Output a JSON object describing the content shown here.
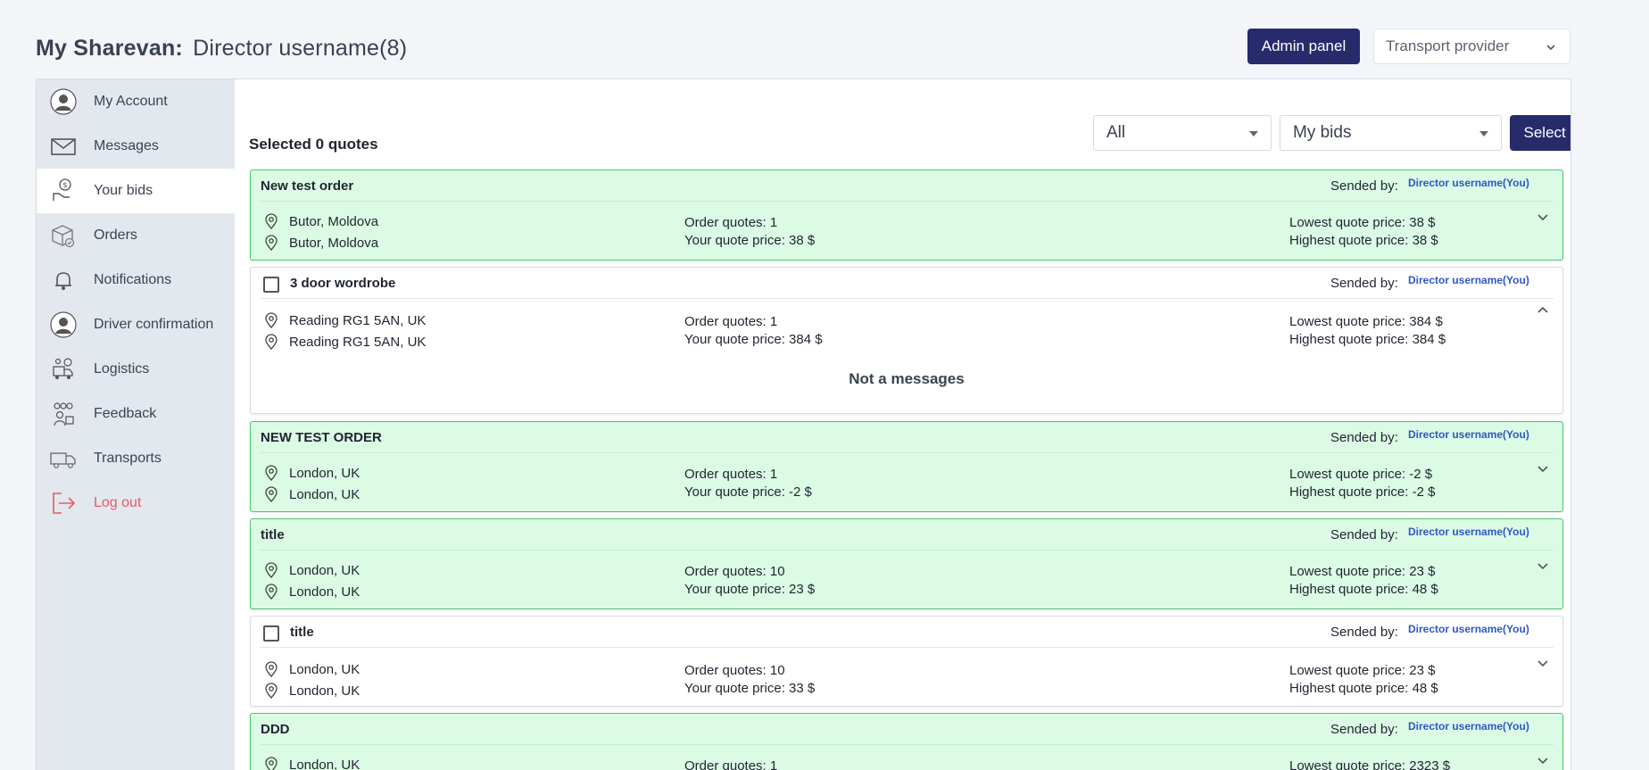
{
  "header": {
    "title": "My Sharevan:",
    "username": "Director username(8)",
    "admin_button": "Admin panel",
    "role_select": "Transport provider"
  },
  "sidebar": {
    "items": [
      {
        "label": "My Account",
        "icon": "user-avatar-icon"
      },
      {
        "label": "Messages",
        "icon": "envelope-icon"
      },
      {
        "label": "Your bids",
        "icon": "bid-icon"
      },
      {
        "label": "Orders",
        "icon": "box-icon"
      },
      {
        "label": "Notifications",
        "icon": "bell-icon"
      },
      {
        "label": "Driver confirmation",
        "icon": "driver-avatar-icon"
      },
      {
        "label": "Logistics",
        "icon": "logistics-icon"
      },
      {
        "label": "Feedback",
        "icon": "feedback-icon"
      },
      {
        "label": "Transports",
        "icon": "truck-icon"
      },
      {
        "label": "Log out",
        "icon": "logout-icon"
      }
    ],
    "active_index": 2
  },
  "toolbar": {
    "selected_text": "Selected 0 quotes",
    "filter_select": "All",
    "bids_select": "My bids",
    "select_all": "Select all"
  },
  "labels": {
    "sended_by": "Sended by:",
    "order_quotes": "Order quotes:",
    "your_quote_price": "Your quote price:",
    "lowest_quote_price": "Lowest quote price:",
    "highest_quote_price": "Highest quote price:"
  },
  "cards": [
    {
      "title": "New test order",
      "green": true,
      "checkbox": false,
      "sender": "Director username(You)",
      "from": "Butor, Moldova",
      "to": "Butor, Moldova",
      "order_quotes": "Order quotes: 1",
      "your_price": "Your quote price: 38 $",
      "lowest": "Lowest quote price: 38 $",
      "highest": "Highest quote price: 38 $",
      "expanded": false
    },
    {
      "title": "3 door wordrobe",
      "green": false,
      "checkbox": true,
      "sender": "Director username(You)",
      "from": "Reading RG1 5AN, UK",
      "to": "Reading RG1 5AN, UK",
      "order_quotes": "Order quotes: 1",
      "your_price": "Your quote price: 384 $",
      "lowest": "Lowest quote price: 384 $",
      "highest": "Highest quote price: 384 $",
      "expanded": true,
      "messages_text": "Not a messages"
    },
    {
      "title": "NEW TEST ORDER",
      "green": true,
      "checkbox": false,
      "sender": "Director username(You)",
      "from": "London, UK",
      "to": "London, UK",
      "order_quotes": "Order quotes: 1",
      "your_price": "Your quote price: -2 $",
      "lowest": "Lowest quote price: -2 $",
      "highest": "Highest quote price: -2 $",
      "expanded": false
    },
    {
      "title": "title",
      "green": true,
      "checkbox": false,
      "sender": "Director username(You)",
      "from": "London, UK",
      "to": "London, UK",
      "order_quotes": "Order quotes: 10",
      "your_price": "Your quote price: 23 $",
      "lowest": "Lowest quote price: 23 $",
      "highest": "Highest quote price: 48 $",
      "expanded": false
    },
    {
      "title": "title",
      "green": false,
      "checkbox": true,
      "sender": "Director username(You)",
      "from": "London, UK",
      "to": "London, UK",
      "order_quotes": "Order quotes: 10",
      "your_price": "Your quote price: 33 $",
      "lowest": "Lowest quote price: 23 $",
      "highest": "Highest quote price: 48 $",
      "expanded": false
    },
    {
      "title": "DDD",
      "green": true,
      "checkbox": false,
      "sender": "Director username(You)",
      "from": "London, UK",
      "to": "",
      "order_quotes": "Order quotes: 1",
      "your_price": "",
      "lowest": "Lowest quote price: 2323 $",
      "highest": "",
      "expanded": false
    }
  ],
  "colors": {
    "primary": "#272b6b",
    "green_bg": "#dcfbe5",
    "green_border": "#4bc46d",
    "link": "#2d58c4",
    "logout": "#e35d5d"
  }
}
